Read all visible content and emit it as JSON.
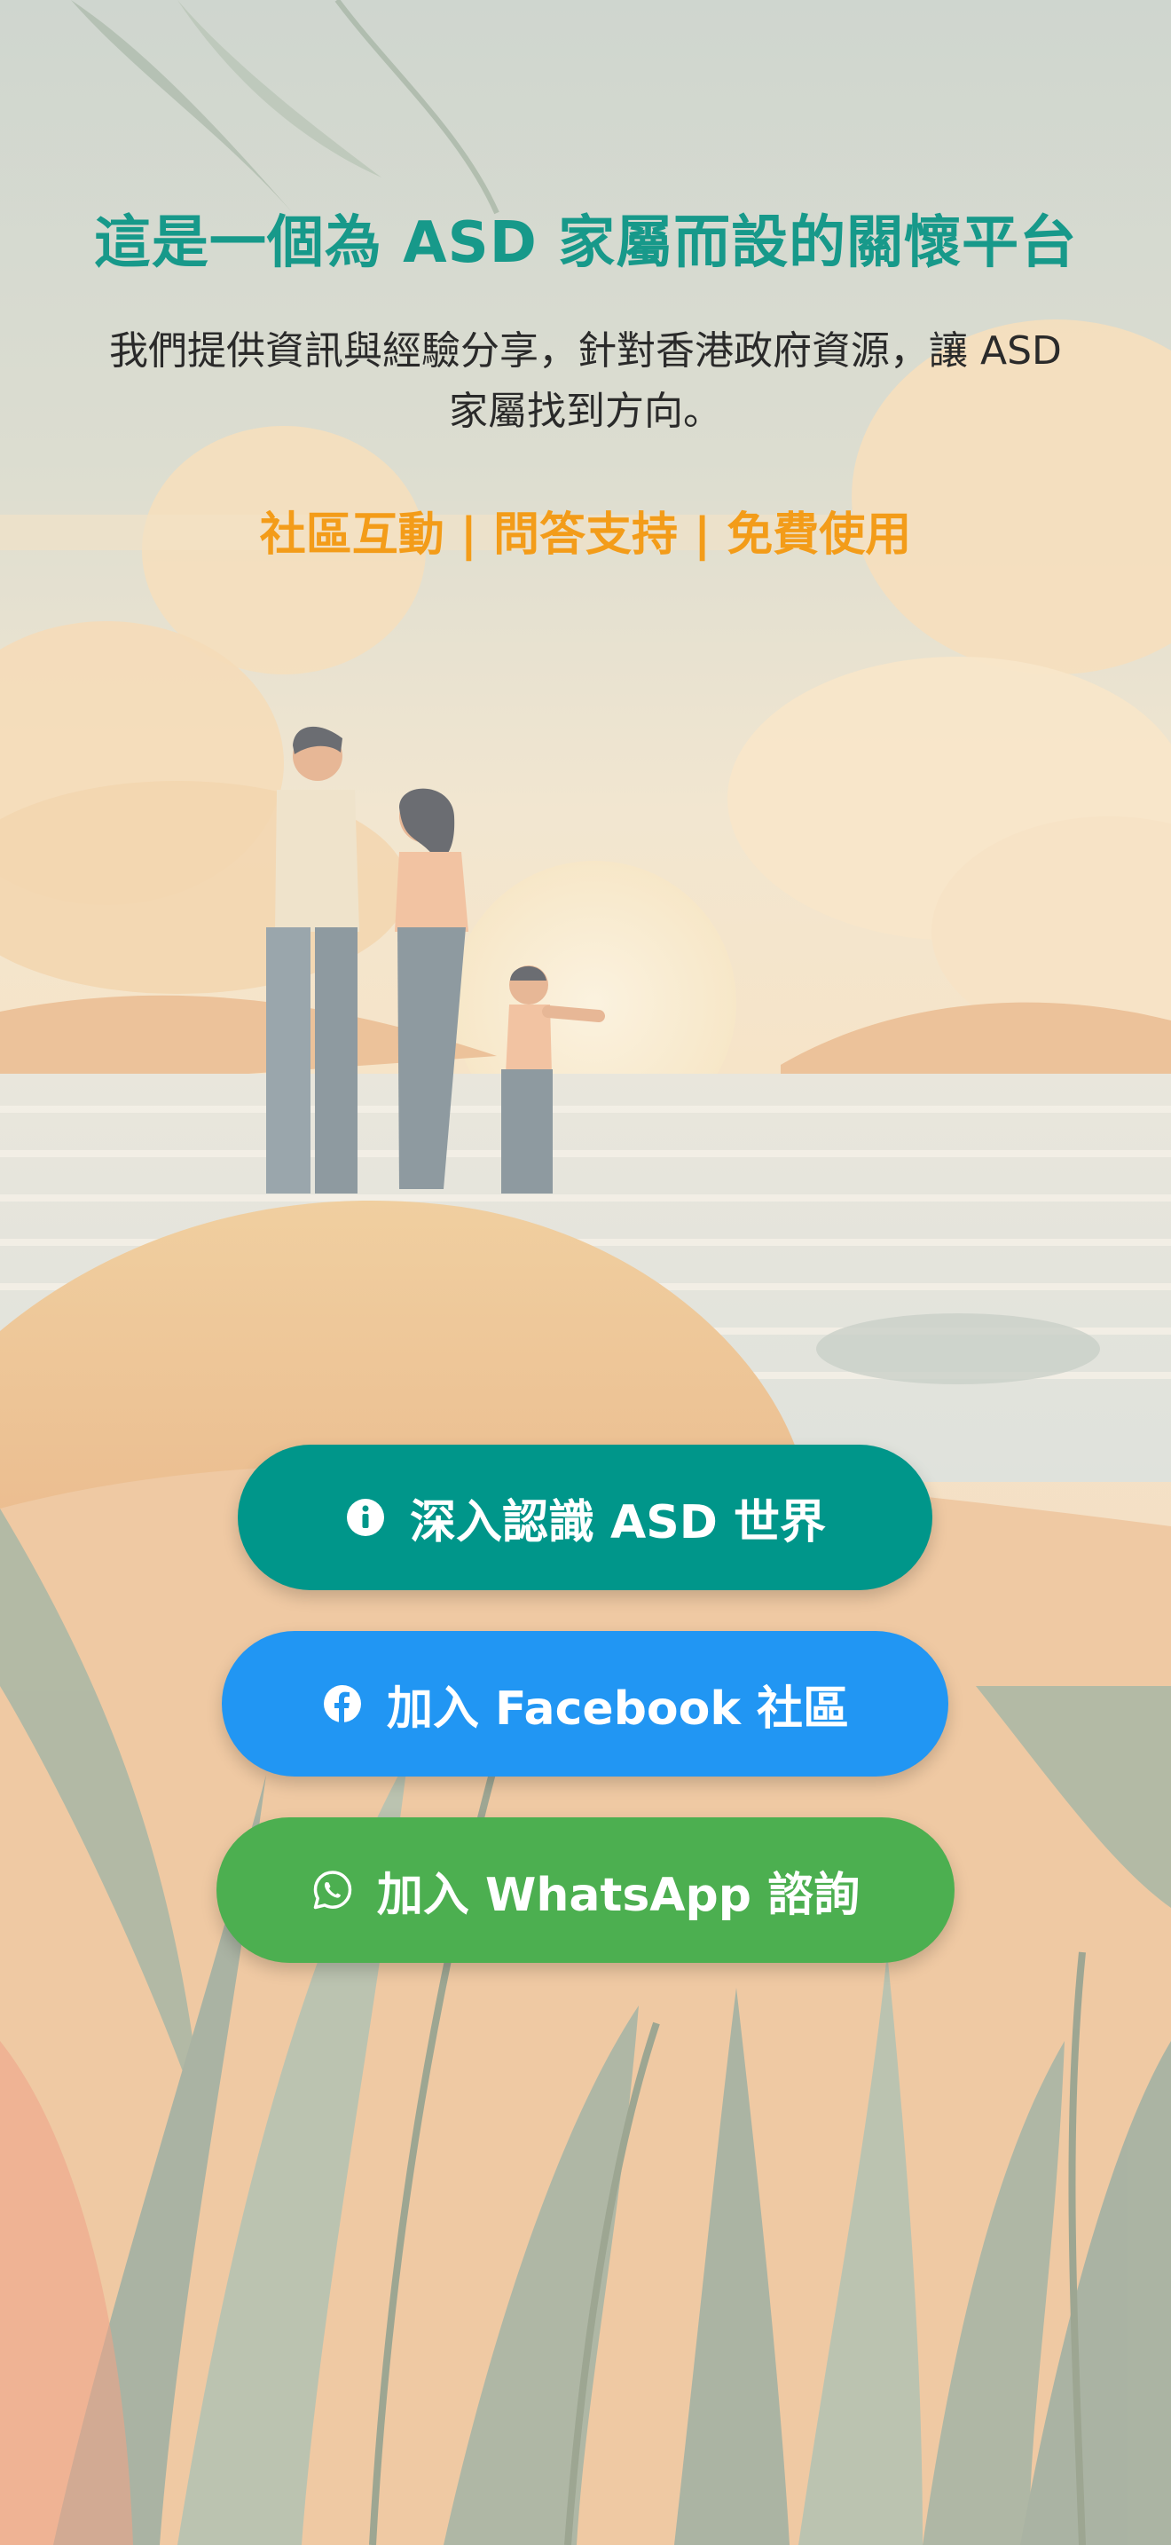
{
  "hero": {
    "title": "這是一個為 ASD 家屬而設的關懷平台",
    "subtitle_line1": "我們提供資訊與經驗分享，針對香港政府資源，讓 ASD",
    "subtitle_line2": "家屬找到方向。",
    "features": "社區互動 | 問答支持 | 免費使用"
  },
  "buttons": [
    {
      "label": "深入認識 ASD 世界",
      "icon": "info-circle-icon",
      "color": "#00968a"
    },
    {
      "label": "加入 Facebook 社區",
      "icon": "facebook-icon",
      "color": "#2196f3"
    },
    {
      "label": "加入 WhatsApp 諮詢",
      "icon": "whatsapp-icon",
      "color": "#4caf50"
    }
  ],
  "colors": {
    "title": "#17998a",
    "features": "#f39c19",
    "subtitle": "#2a2a2a"
  }
}
